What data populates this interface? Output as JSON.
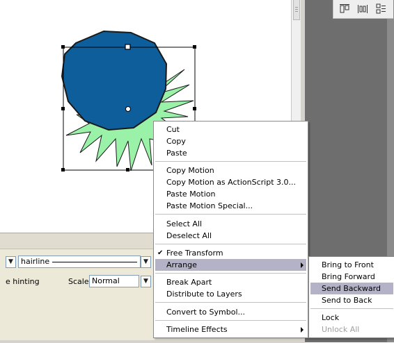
{
  "canvas": {
    "colors": {
      "fill": "#0d5e9a",
      "starburst": "#99f2a8",
      "stroke": "#1a1a1a"
    }
  },
  "properties_panel": {
    "stroke_style": "hairline",
    "hinting_label": "e hinting",
    "scale_label": "Scale:",
    "scale_value": "Normal"
  },
  "context_menu": {
    "items": [
      {
        "label": "Cut"
      },
      {
        "label": "Copy"
      },
      {
        "label": "Paste"
      },
      {
        "label": "Copy Motion"
      },
      {
        "label": "Copy Motion as ActionScript 3.0..."
      },
      {
        "label": "Paste Motion"
      },
      {
        "label": "Paste Motion Special..."
      },
      {
        "label": "Select All"
      },
      {
        "label": "Deselect All"
      },
      {
        "label": "Free Transform",
        "checked": true
      },
      {
        "label": "Arrange",
        "submenu": true,
        "highlighted": true
      },
      {
        "label": "Break Apart"
      },
      {
        "label": "Distribute to Layers"
      },
      {
        "label": "Convert to Symbol..."
      },
      {
        "label": "Timeline Effects",
        "submenu": true
      }
    ]
  },
  "arrange_submenu": {
    "items": [
      {
        "label": "Bring to Front"
      },
      {
        "label": "Bring Forward"
      },
      {
        "label": "Send Backward",
        "highlighted": true
      },
      {
        "label": "Send to Back"
      },
      {
        "label": "Lock"
      },
      {
        "label": "Unlock All",
        "disabled": true
      }
    ]
  }
}
